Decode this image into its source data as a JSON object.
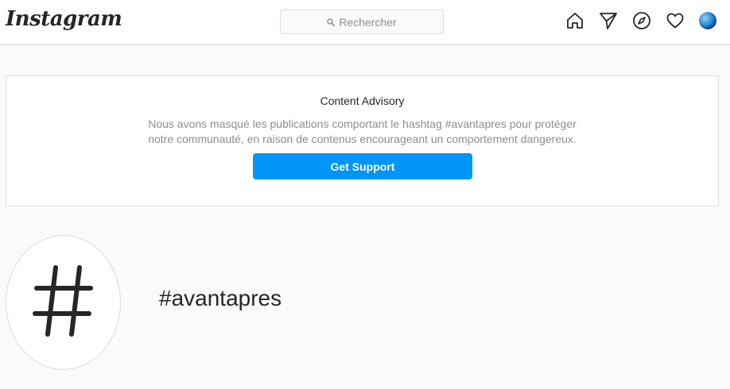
{
  "header": {
    "logo_text": "Instagram",
    "search_placeholder": "Rechercher",
    "nav_icons": [
      "home-icon",
      "direct-message-icon",
      "explore-icon",
      "activity-heart-icon",
      "profile-avatar"
    ]
  },
  "advisory": {
    "title": "Content Advisory",
    "body_line1": "Nous avons masqué les publications comportant le hashtag #avantapres pour protéger",
    "body_line2": "notre communauté, en raison de contenus encourageant un comportement dangereux.",
    "button_label": "Get Support"
  },
  "hashtag": {
    "name": "#avantapres",
    "icon": "hashtag-icon"
  },
  "colors": {
    "accent": "#0095f6",
    "text_primary": "#262626",
    "text_secondary": "#8e8e8e",
    "border": "#dbdbdb",
    "background": "#fafafa"
  }
}
